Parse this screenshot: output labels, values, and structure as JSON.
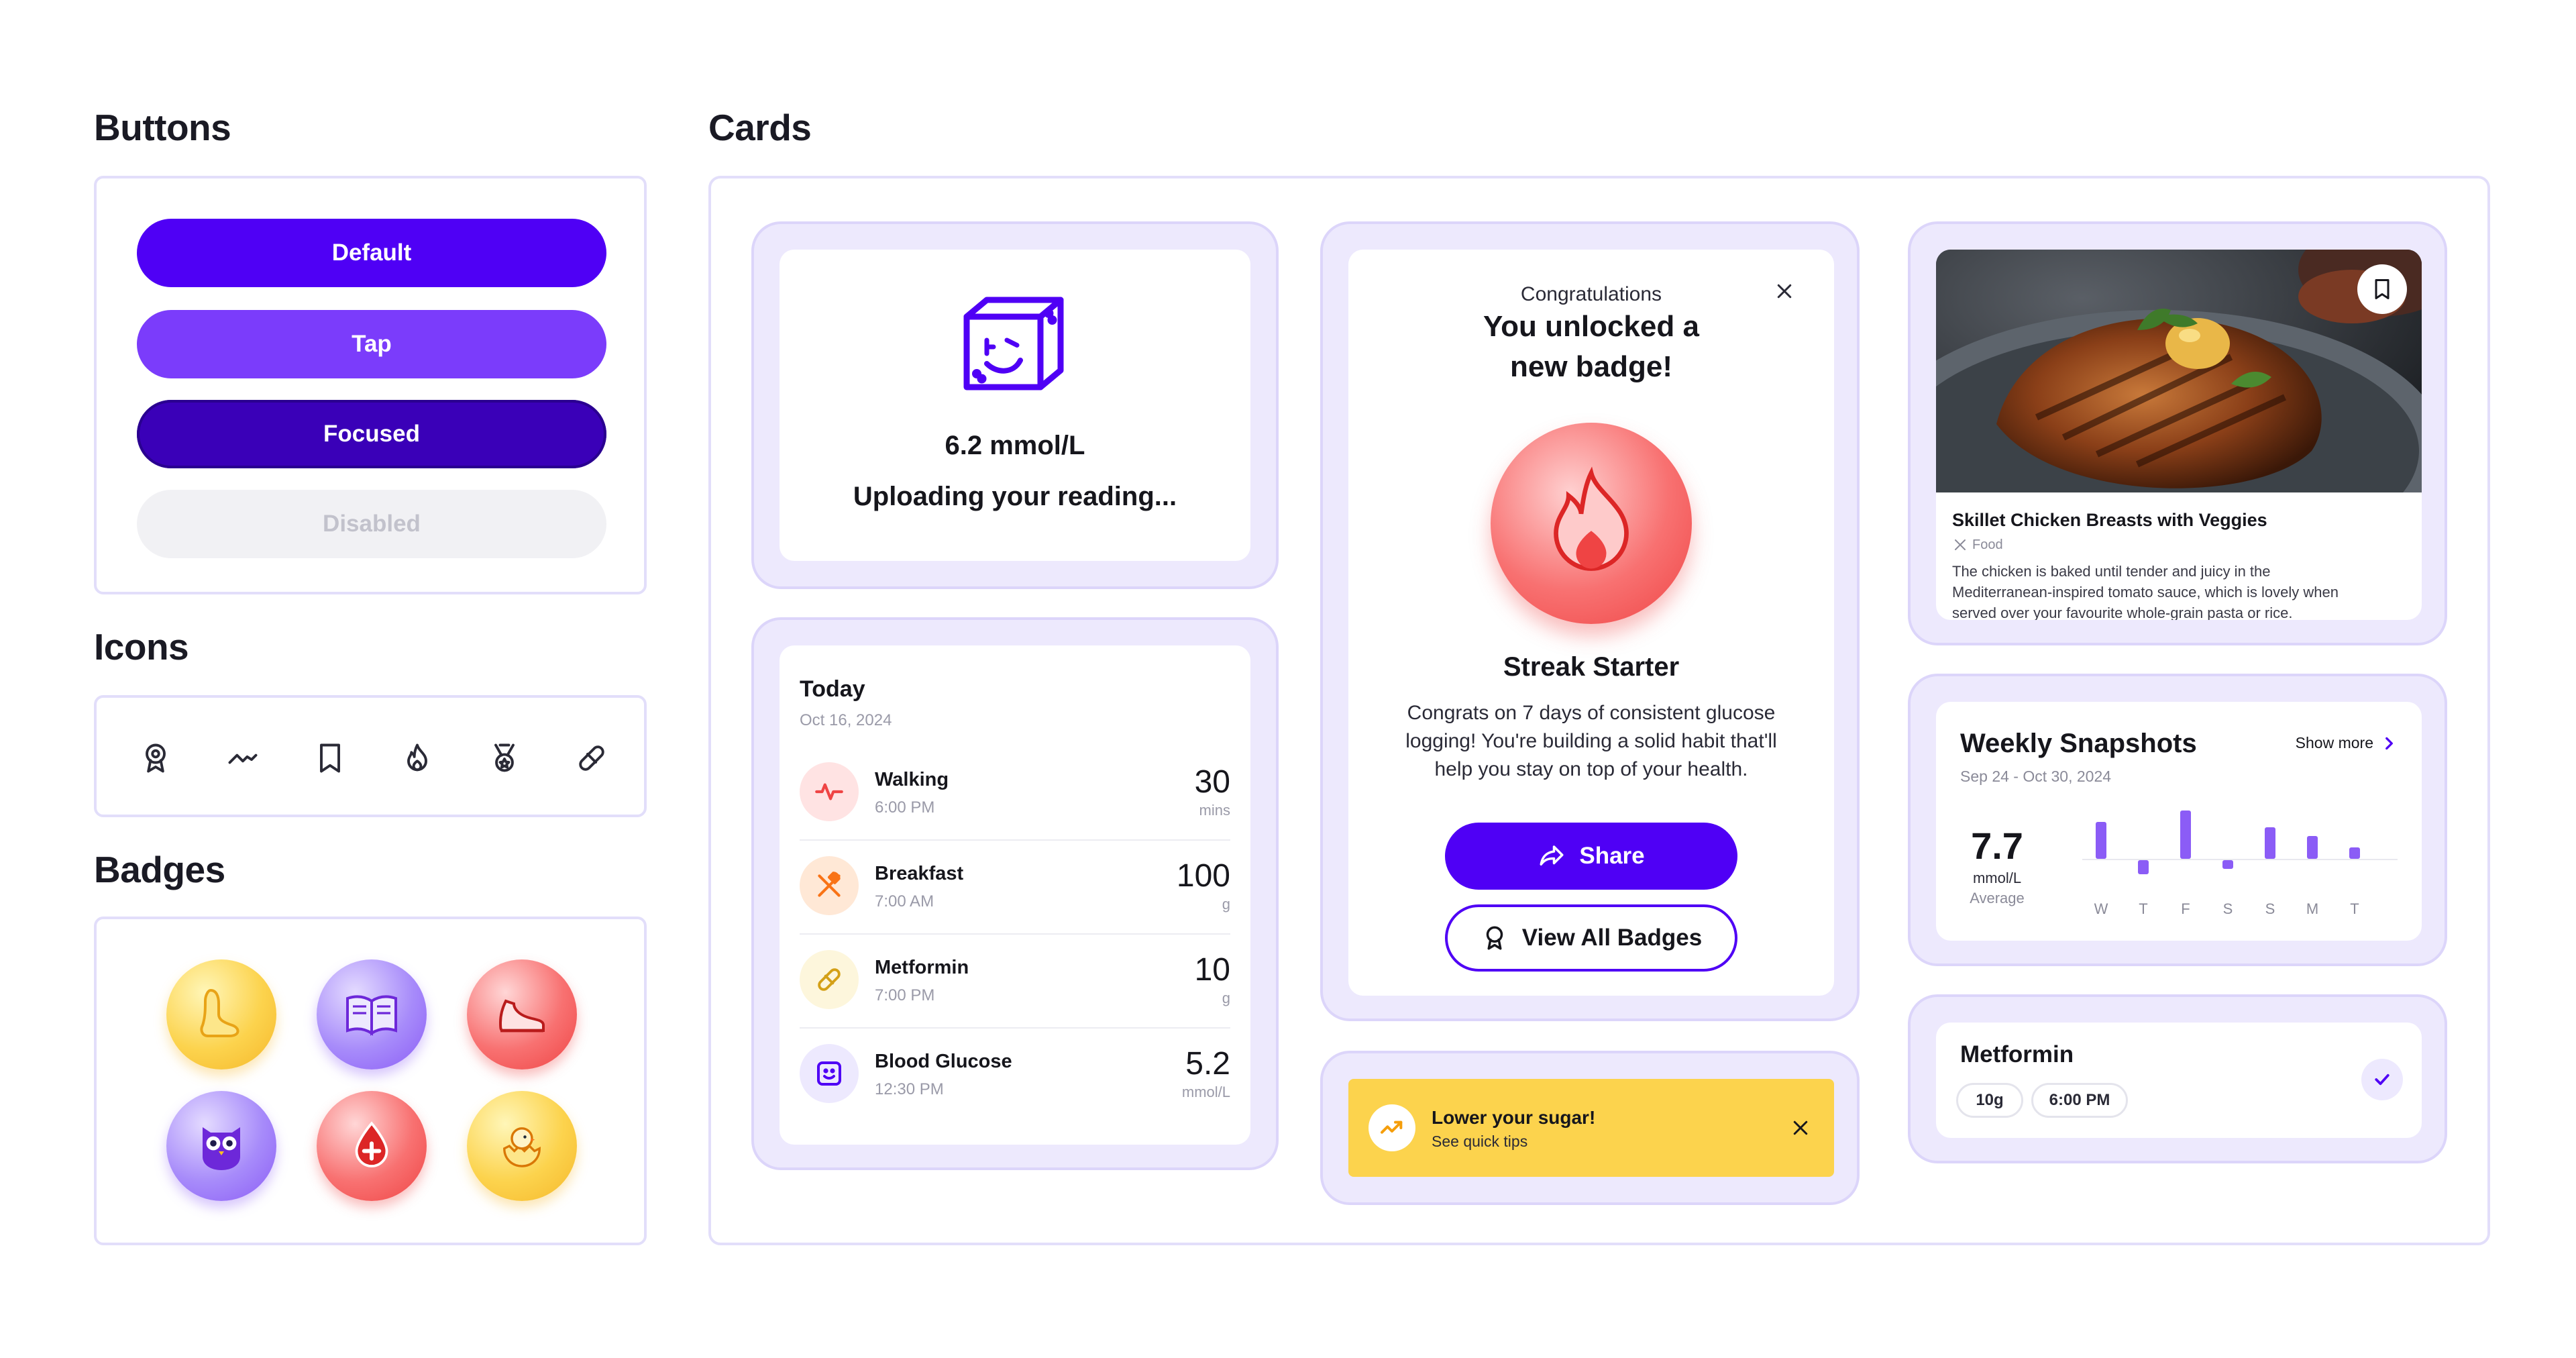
{
  "sections": {
    "buttons": "Buttons",
    "icons": "Icons",
    "badges": "Badges",
    "cards": "Cards"
  },
  "buttons": [
    {
      "label": "Default",
      "state": "default",
      "color": "#4f00f5"
    },
    {
      "label": "Tap",
      "state": "tap",
      "color": "#7b3cfb"
    },
    {
      "label": "Focused",
      "state": "focused",
      "color": "#3a00b8"
    },
    {
      "label": "Disabled",
      "state": "disabled",
      "color": "#f1f1f4"
    }
  ],
  "icons": [
    "badge-icon",
    "trend-icon",
    "bookmark-icon",
    "flame-icon",
    "medal-icon",
    "pill-icon"
  ],
  "badges": [
    {
      "name": "foot-badge",
      "color": "yellow"
    },
    {
      "name": "book-badge",
      "color": "purple"
    },
    {
      "name": "shoe-badge",
      "color": "red"
    },
    {
      "name": "owl-badge",
      "color": "purple"
    },
    {
      "name": "blood-drop-badge",
      "color": "red"
    },
    {
      "name": "chick-badge",
      "color": "yellow"
    }
  ],
  "upload_card": {
    "value": "6.2 mmol/L",
    "message": "Uploading your reading..."
  },
  "today_card": {
    "title": "Today",
    "date": "Oct 16, 2024",
    "items": [
      {
        "title": "Walking",
        "time": "6:00 PM",
        "value": "30",
        "unit": "mins",
        "icon": "activity-icon"
      },
      {
        "title": "Breakfast",
        "time": "7:00 AM",
        "value": "100",
        "unit": "g",
        "icon": "utensils-icon"
      },
      {
        "title": "Metformin",
        "time": "7:00 PM",
        "value": "10",
        "unit": "g",
        "icon": "pill-icon"
      },
      {
        "title": "Blood Glucose",
        "time": "12:30 PM",
        "value": "5.2",
        "unit": "mmol/L",
        "icon": "smiley-icon"
      }
    ]
  },
  "badge_card": {
    "pretitle": "Congratulations",
    "title_line1": "You unlocked a",
    "title_line2": "new badge!",
    "badge_name": "Streak Starter",
    "description_line1": "Congrats on 7 days of consistent glucose",
    "description_line2": "logging! You're building a solid habit that'll",
    "description_line3": "help you stay on top of your health.",
    "share_label": "Share",
    "view_all_label": "View All Badges"
  },
  "tip_banner": {
    "title": "Lower your sugar!",
    "subtitle": "See quick tips"
  },
  "recipe_card": {
    "title": "Skillet Chicken Breasts with Veggies",
    "category": "Food",
    "description_line1": "The chicken is baked until tender and juicy in the",
    "description_line2": "Mediterranean-inspired tomato sauce, which is lovely when",
    "description_line3": "served over  your favourite whole-grain pasta or rice."
  },
  "weekly_card": {
    "title": "Weekly Snapshots",
    "show_more": "Show more",
    "date_range": "Sep 24 - Oct 30, 2024",
    "average_value": "7.7",
    "average_unit": "mmol/L",
    "average_label": "Average"
  },
  "chart_data": {
    "type": "bar",
    "categories": [
      "W",
      "T",
      "F",
      "S",
      "S",
      "M",
      "T"
    ],
    "values": [
      0.65,
      -0.25,
      0.85,
      -0.15,
      0.55,
      0.4,
      0.2
    ],
    "title": "",
    "xlabel": "",
    "ylabel": "",
    "grid": false,
    "color": "#8b5cf6"
  },
  "med_card": {
    "title": "Metformin",
    "dose": "10g",
    "time": "6:00 PM",
    "checked": true
  }
}
